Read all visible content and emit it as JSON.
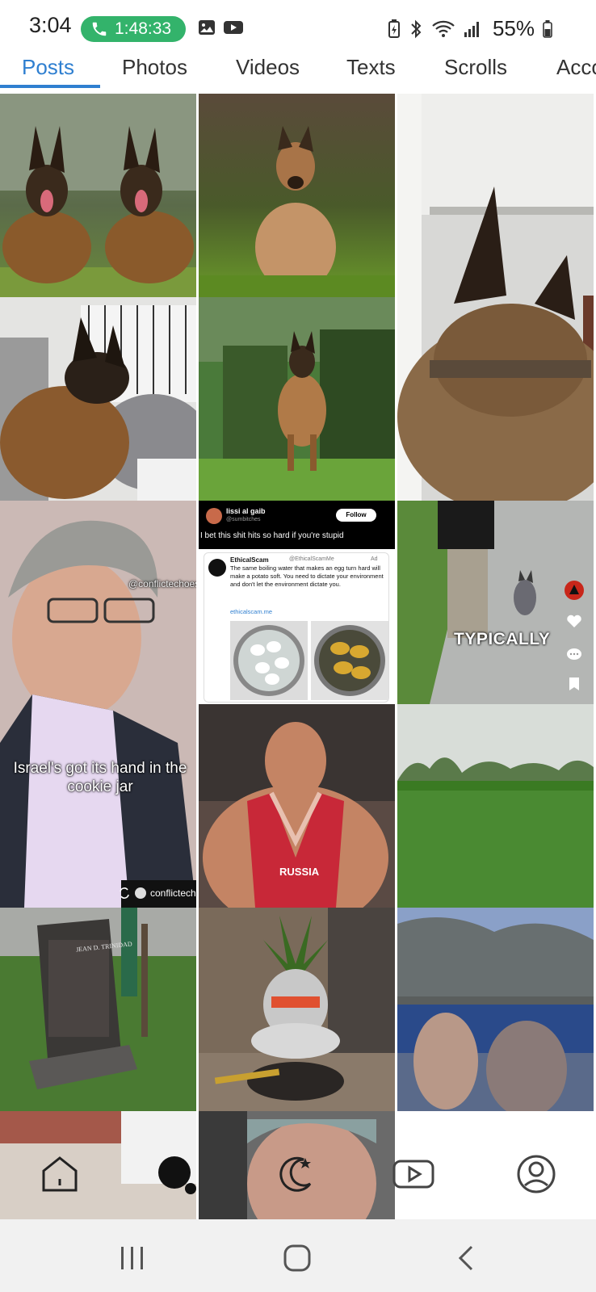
{
  "status_bar": {
    "time": "3:04",
    "call_timer": "1:48:33",
    "battery": "55%"
  },
  "tabs": [
    {
      "label": "Posts",
      "active": true
    },
    {
      "label": "Photos",
      "active": false
    },
    {
      "label": "Videos",
      "active": false
    },
    {
      "label": "Texts",
      "active": false
    },
    {
      "label": "Scrolls",
      "active": false
    },
    {
      "label": "Acco",
      "active": false
    }
  ],
  "tiles": {
    "tweet": {
      "user_name": "lissi al gaib",
      "user_handle": "@sumbitches",
      "follow_label": "Follow",
      "text": "I bet this shit hits so hard if you're stupid",
      "ad_name": "EthicalScam",
      "ad_handle": "@EthicalScamMe",
      "ad_label": "Ad",
      "ad_body": "The same boiling water that makes an egg turn hard will make a potato soft. You need to dictate your environment and don't let the environment dictate you.",
      "ad_link": "ethicalscam.me"
    },
    "video_watermark": "@conflictechoes",
    "video_caption": "Israel's got its hand in the cookie jar",
    "video_channel": "conflictech",
    "typically_caption": "TYPICALLY",
    "wrestler_text": "RUSSIA",
    "grave_text": "JEAN D. TRINIDAD"
  },
  "icons": {
    "call": "phone-icon",
    "home": "home-icon",
    "profile": "profile-icon",
    "moon": "moon-icon",
    "video": "play-icon"
  },
  "colors": {
    "accent": "#2f7fd0",
    "call_pill": "#33b36b"
  }
}
